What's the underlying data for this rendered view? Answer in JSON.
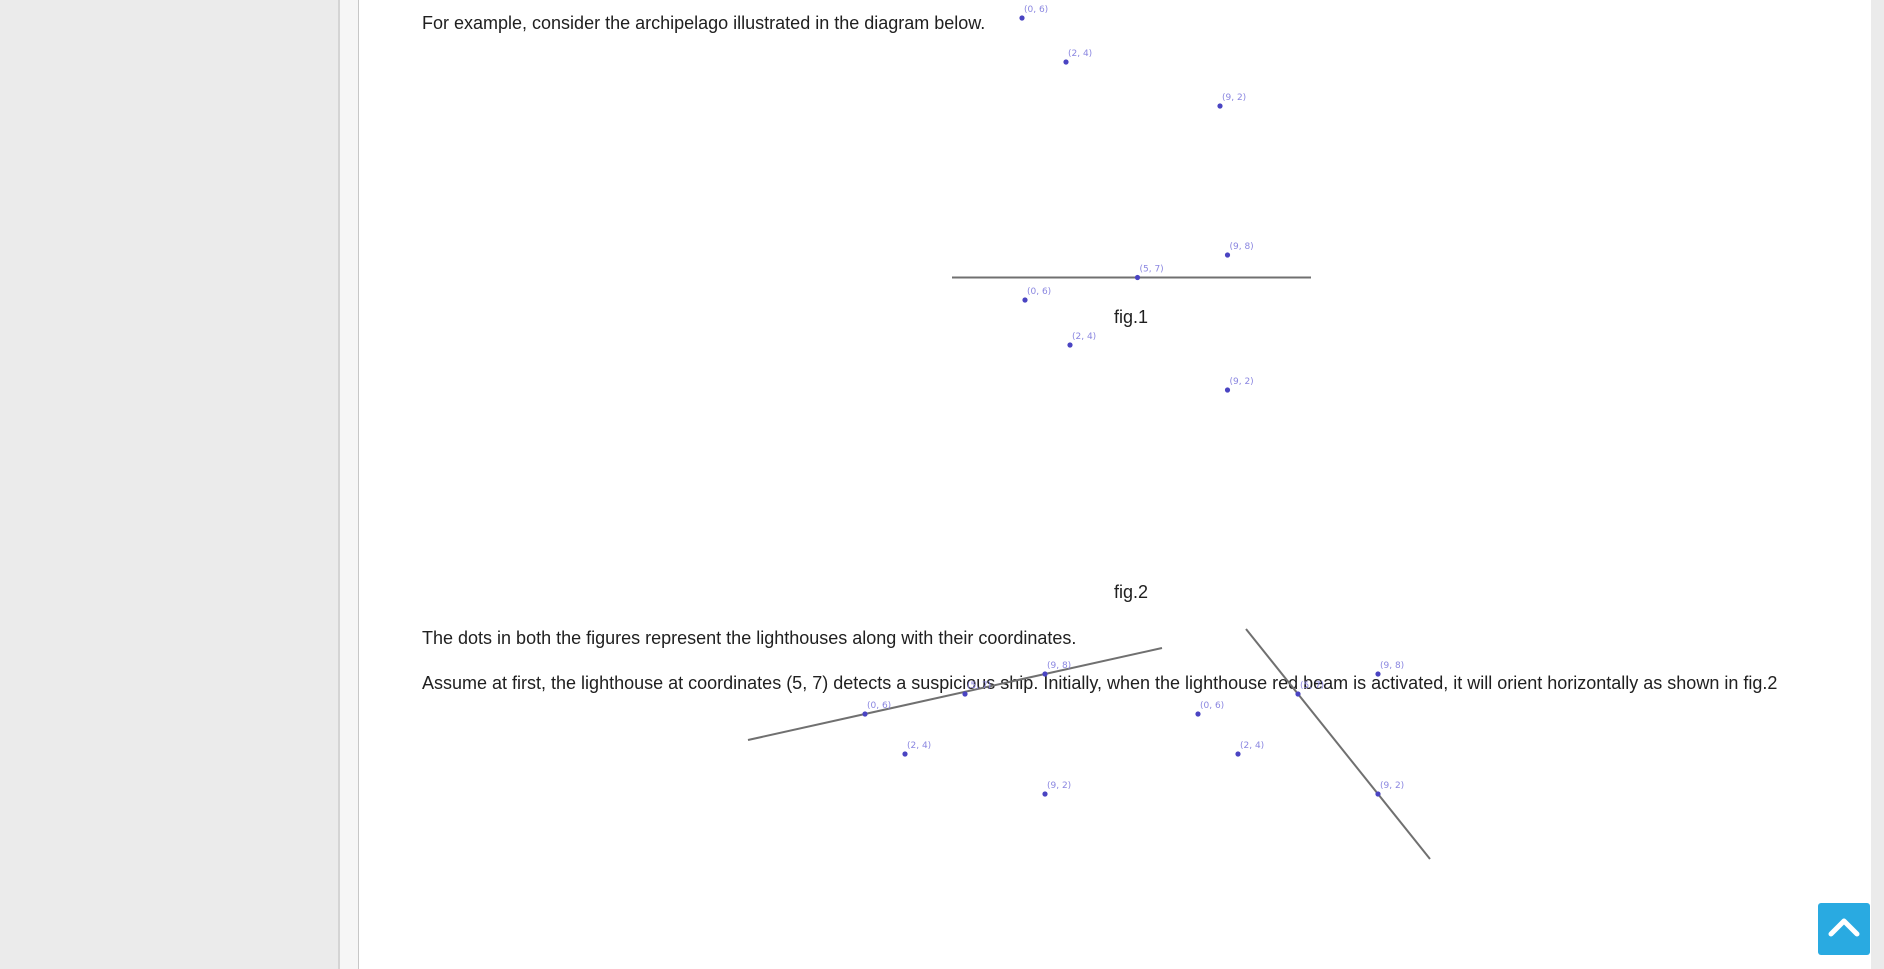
{
  "content": {
    "intro": "For example, consider the archipelago illustrated in the diagram below.",
    "dots_text": "The dots in both the figures represent the lighthouses along with their coordinates.",
    "assume_text": "Assume at first, the lighthouse at coordinates (5, 7) detects a suspicious ship. Initially, when the lighthouse red beam is activated, it will orient horizontally as shown in fig.2"
  },
  "figures": {
    "fig1": {
      "caption": "fig.1",
      "points": [
        {
          "label": "(0, 6)",
          "x": 0,
          "y": 6
        },
        {
          "label": "(5, 7)",
          "x": 5,
          "y": 7
        },
        {
          "label": "(9, 8)",
          "x": 9,
          "y": 8
        },
        {
          "label": "(2, 4)",
          "x": 2,
          "y": 4
        },
        {
          "label": "(9, 2)",
          "x": 9,
          "y": 2
        }
      ]
    },
    "fig2": {
      "caption": "fig.2",
      "points": [
        {
          "label": "(0, 6)",
          "x": 0,
          "y": 6
        },
        {
          "label": "(5, 7)",
          "x": 5,
          "y": 7
        },
        {
          "label": "(9, 8)",
          "x": 9,
          "y": 8
        },
        {
          "label": "(2, 4)",
          "x": 2,
          "y": 4
        },
        {
          "label": "(9, 2)",
          "x": 9,
          "y": 2
        }
      ],
      "beam": {
        "through": [
          5,
          7
        ],
        "orientation": "horizontal"
      }
    },
    "fig3": {
      "points": [
        {
          "label": "(0, 6)",
          "x": 0,
          "y": 6
        },
        {
          "label": "(5, 7)",
          "x": 5,
          "y": 7
        },
        {
          "label": "(9, 8)",
          "x": 9,
          "y": 8
        },
        {
          "label": "(2, 4)",
          "x": 2,
          "y": 4
        },
        {
          "label": "(9, 2)",
          "x": 9,
          "y": 2
        }
      ],
      "beam": {
        "through": [
          [
            0,
            6
          ],
          [
            5,
            7
          ],
          [
            9,
            8
          ]
        ]
      }
    },
    "fig4": {
      "points": [
        {
          "label": "(0, 6)",
          "x": 0,
          "y": 6
        },
        {
          "label": "(5, 7)",
          "x": 5,
          "y": 7
        },
        {
          "label": "(9, 8)",
          "x": 9,
          "y": 8
        },
        {
          "label": "(2, 4)",
          "x": 2,
          "y": 4
        },
        {
          "label": "(9, 2)",
          "x": 9,
          "y": 2
        }
      ],
      "beam": {
        "through": [
          [
            5,
            7
          ],
          [
            9,
            2
          ]
        ]
      }
    }
  },
  "colors": {
    "dot": "#4a44c2",
    "label": "#8a86e0",
    "beam": "#707070",
    "scroll_button": "#29aae1"
  },
  "controls": {
    "scroll_top_icon": "chevron-up-icon"
  }
}
